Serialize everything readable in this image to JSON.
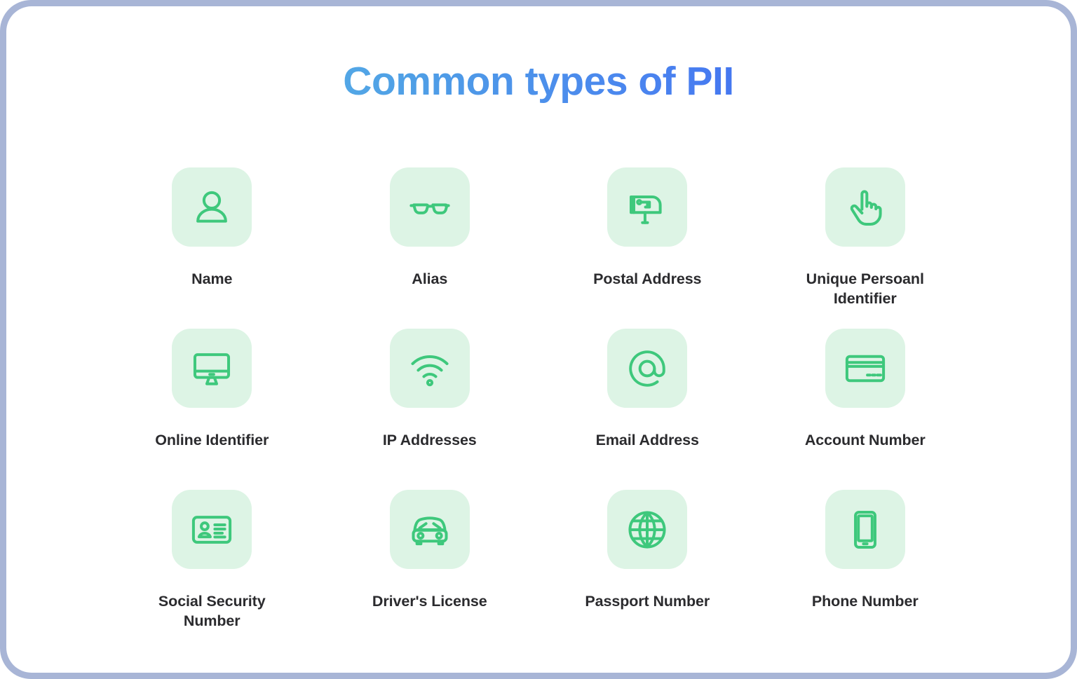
{
  "header": {
    "title": "Common types of PII",
    "title_gradient_from": "#6ec9ea",
    "title_gradient_to": "#3a57f0"
  },
  "theme": {
    "frame_border": "#a8b5d6",
    "card_background": "#ffffff",
    "tile_background": "#ddf4e5",
    "icon_stroke": "#3ec87c",
    "label_color": "#2b2b2e"
  },
  "grid": {
    "columns": 4,
    "rows": 3,
    "items": [
      {
        "label": "Name",
        "icon": "person-icon"
      },
      {
        "label": "Alias",
        "icon": "sunglasses-icon"
      },
      {
        "label": "Postal Address",
        "icon": "mailbox-icon"
      },
      {
        "label": "Unique Persoanl Identifier",
        "icon": "pointing-hand-icon"
      },
      {
        "label": "Online Identifier",
        "icon": "desktop-monitor-icon"
      },
      {
        "label": "IP Addresses",
        "icon": "wifi-icon"
      },
      {
        "label": "Email Address",
        "icon": "at-sign-icon"
      },
      {
        "label": "Account Number",
        "icon": "credit-card-icon"
      },
      {
        "label": "Social Security Number",
        "icon": "id-card-icon"
      },
      {
        "label": "Driver's License",
        "icon": "car-icon"
      },
      {
        "label": "Passport Number",
        "icon": "globe-icon"
      },
      {
        "label": "Phone Number",
        "icon": "smartphone-icon"
      }
    ]
  }
}
